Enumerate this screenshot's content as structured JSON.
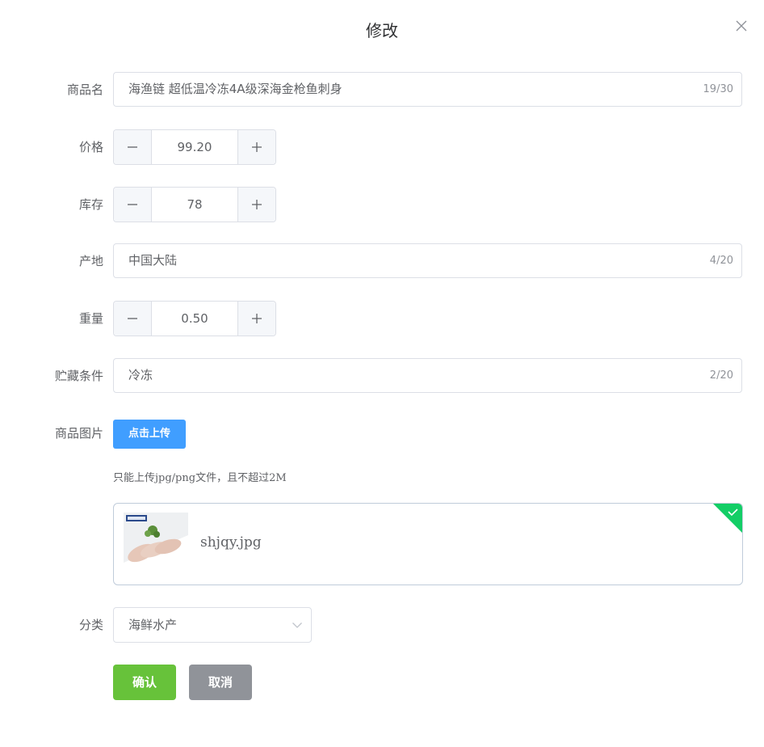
{
  "dialog": {
    "title": "修改",
    "close_icon": "close-icon"
  },
  "form": {
    "name": {
      "label": "商品名",
      "value": "海渔链 超低温冷冻4A级深海金枪鱼刺身",
      "count": "19/30"
    },
    "price": {
      "label": "价格",
      "value": "99.20",
      "minus_icon": "minus-icon",
      "plus_icon": "plus-icon"
    },
    "stock": {
      "label": "库存",
      "value": "78",
      "minus_icon": "minus-icon",
      "plus_icon": "plus-icon"
    },
    "origin": {
      "label": "产地",
      "value": "中国大陆",
      "count": "4/20"
    },
    "weight": {
      "label": "重量",
      "value": "0.50",
      "minus_icon": "minus-icon",
      "plus_icon": "plus-icon"
    },
    "storage": {
      "label": "贮藏条件",
      "value": "冷冻",
      "count": "2/20"
    },
    "image": {
      "label": "商品图片",
      "upload_label": "点击上传",
      "tip": "只能上传jpg/png文件，且不超过2M",
      "file_name": "shjqy.jpg",
      "status_icon": "check-icon",
      "status_color": "#13ce66"
    },
    "category": {
      "label": "分类",
      "value": "海鲜水产",
      "arrow_icon": "chevron-down-icon"
    }
  },
  "actions": {
    "confirm_label": "确认",
    "cancel_label": "取消",
    "confirm_color": "#67c23a",
    "cancel_color": "#909399"
  },
  "colors": {
    "primary": "#409eff",
    "border": "#dcdfe6",
    "text": "#606266"
  }
}
